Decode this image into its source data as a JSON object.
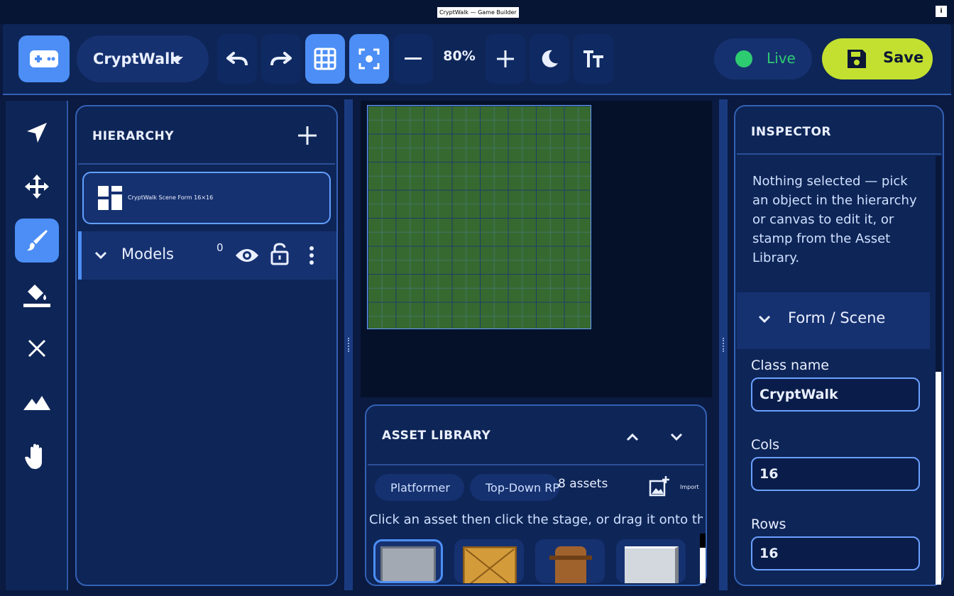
{
  "window": {
    "title": "CryptWalk — Game Builder",
    "menu_glyph": "i"
  },
  "toolbar": {
    "project_name": "CryptWalk",
    "zoom": "80%",
    "status_label": "Live",
    "save_label": "Save",
    "icons": [
      "gamepad-icon",
      "undo-icon",
      "redo-icon",
      "grid-icon",
      "focus-icon",
      "zoom-out-icon",
      "zoom-in-icon",
      "moon-icon",
      "text-size-icon",
      "save-icon"
    ],
    "active": [
      "gamepad",
      "grid",
      "focus"
    ]
  },
  "tools": [
    {
      "name": "select",
      "icon": "navigation-arrow-icon",
      "active": false
    },
    {
      "name": "move",
      "icon": "move-arrows-icon",
      "active": false
    },
    {
      "name": "paint",
      "icon": "paintbrush-icon",
      "active": true
    },
    {
      "name": "fill",
      "icon": "paint-bucket-icon",
      "active": false
    },
    {
      "name": "erase",
      "icon": "close-icon",
      "active": false
    },
    {
      "name": "terrain",
      "icon": "mountain-icon",
      "active": false
    },
    {
      "name": "pan",
      "icon": "hand-icon",
      "active": false
    }
  ],
  "hierarchy": {
    "title": "HIERARCHY",
    "scene_item": "CryptWalk Scene   Form 16×16",
    "models": {
      "label": "Models",
      "count": "0"
    }
  },
  "stage": {
    "cols": 16,
    "rows": 16
  },
  "asset_library": {
    "title": "ASSET LIBRARY",
    "chips": [
      "Platformer",
      "Top-Down RPG"
    ],
    "count": "8 assets",
    "import_label": "Import",
    "hint": "Click an asset then click the stage, or drag it onto the stage.",
    "tiles": [
      "stone-block",
      "wooden-crate",
      "barrel",
      "white-block"
    ]
  },
  "inspector": {
    "title": "INSPECTOR",
    "message": "Nothing selected — pick an object in the hierarchy or canvas to edit it, or stamp from the Asset Library.",
    "section": "Form / Scene",
    "fields": {
      "class_name_label": "Class name",
      "class_name": "CryptWalk",
      "cols_label": "Cols",
      "cols": "16",
      "rows_label": "Rows",
      "rows": "16"
    }
  },
  "colors": {
    "accent": "#4c8ef5",
    "live": "#2ecc71",
    "save": "#c3e030",
    "panel": "#0e2557",
    "grass": "#36692f"
  }
}
